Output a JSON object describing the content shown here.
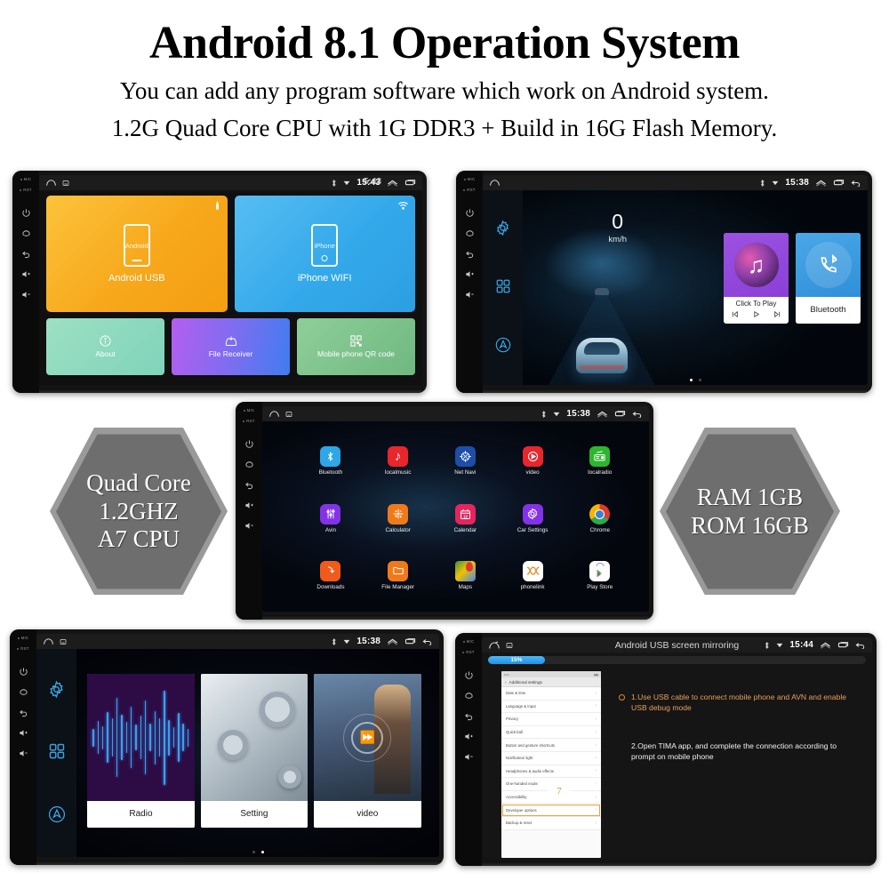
{
  "header": {
    "title": "Android 8.1 Operation System",
    "line1": "You can add any program software which work on Android system.",
    "line2": "1.2G Quad Core CPU with 1G DDR3 + Build in 16G Flash Memory."
  },
  "bezel": {
    "mic_label": "MIC",
    "rst_label": "RST",
    "buttons": [
      "power-icon",
      "home-icon",
      "back-icon",
      "volume-up-icon",
      "volume-down-icon"
    ],
    "vol_up": "+",
    "vol_down": "-"
  },
  "screen1": {
    "status": {
      "time": "15:43",
      "ghost_time": "5:43",
      "icons": [
        "home-icon",
        "screenshot-icon",
        "bluetooth-icon",
        "wifi-icon",
        "chevron-up-icon",
        "recents-icon",
        "back-icon"
      ]
    },
    "tiles": [
      {
        "label": "Android USB",
        "phone_text": "Android",
        "corner_icon": "usb-icon",
        "color": "#f7a81b"
      },
      {
        "label": "iPhone WIFI",
        "phone_text": "iPhone",
        "corner_icon": "wifi-icon",
        "color": "#34a9ea"
      }
    ],
    "mini_tiles": [
      {
        "label": "About",
        "icon": "info-icon"
      },
      {
        "label": "File Receiver",
        "icon": "inbox-download-icon"
      },
      {
        "label": "Mobile phone QR code",
        "icon": "qr-code-icon"
      }
    ]
  },
  "screen2": {
    "status": {
      "time": "15:38"
    },
    "speed": {
      "value": "0",
      "unit": "km/h"
    },
    "cards": [
      {
        "title": "Click To Play",
        "icon": "music-note-icon",
        "controls": [
          "previous-icon",
          "play-icon",
          "next-icon"
        ]
      },
      {
        "title": "Bluetooth",
        "icon": "bluetooth-phone-icon"
      }
    ],
    "rail_icons": [
      "settings-gear-icon",
      "apps-grid-icon",
      "assistant-icon"
    ],
    "page_dots": {
      "count": 2,
      "active": 0
    }
  },
  "screen3": {
    "status": {
      "time": "15:38"
    },
    "apps": [
      {
        "label": "Bluetooth",
        "icon": "bluetooth-icon",
        "color": "#2ea6e8"
      },
      {
        "label": "localmusic",
        "icon": "music-note-icon",
        "color": "#e8262b"
      },
      {
        "label": "Net Navi",
        "icon": "compass-icon",
        "color": "#1d4ea8"
      },
      {
        "label": "video",
        "icon": "play-circle-icon",
        "color": "#e8262b"
      },
      {
        "label": "localradio",
        "icon": "radio-icon",
        "color": "#2fb62f"
      },
      {
        "label": "Avin",
        "icon": "equalizer-icon",
        "color": "#8432e8"
      },
      {
        "label": "Calculator",
        "icon": "calculator-icon",
        "color": "#f07a1a"
      },
      {
        "label": "Calendar",
        "icon": "calendar-icon",
        "color": "#e8245c"
      },
      {
        "label": "Car Settings",
        "icon": "gear-icon",
        "color": "#8432e8"
      },
      {
        "label": "Chrome",
        "icon": "chrome-icon",
        "color": "#ffffff"
      },
      {
        "label": "Downloads",
        "icon": "download-icon",
        "color": "#f05a1a"
      },
      {
        "label": "File Manager",
        "icon": "folder-icon",
        "color": "#f07a1a"
      },
      {
        "label": "Maps",
        "icon": "maps-pin-icon",
        "color": "#ffffff"
      },
      {
        "label": "phonelink",
        "icon": "phonelink-icon",
        "color": "#ffffff"
      },
      {
        "label": "Play Store",
        "icon": "play-store-icon",
        "color": "#ffffff"
      }
    ]
  },
  "screen4": {
    "status": {
      "time": "15:38"
    },
    "cards": [
      {
        "label": "Radio",
        "art": "waveform-art"
      },
      {
        "label": "Setting",
        "art": "gears-art"
      },
      {
        "label": "video",
        "art": "movie-art"
      }
    ],
    "rail_icons": [
      "settings-gear-icon",
      "apps-grid-icon",
      "assistant-icon"
    ],
    "page_dots": {
      "count": 2,
      "active": 1
    }
  },
  "screen5": {
    "status": {
      "time": "15:44",
      "title": "Android USB screen mirroring"
    },
    "progress": {
      "percent_label": "15%",
      "percent": 15
    },
    "phone": {
      "header": "Additional settings",
      "rows": [
        "Date & time",
        "Language & input",
        "Privacy",
        "Quick ball",
        "Button and gesture shortcuts",
        "Notification light",
        "Headphones & audio effects",
        "One-handed mode",
        "Accessibility",
        "Developer options",
        "Backup & reset"
      ],
      "highlight_row": "Developer options",
      "badge": "7"
    },
    "steps": [
      "1.Use USB cable to connect mobile phone and AVN and enable USB debug mode",
      "2.Open TIMA app, and complete the connection according to prompt on mobile phone"
    ]
  },
  "hex_left": {
    "line1": "Quad Core",
    "line2": "1.2GHZ",
    "line3": "A7 CPU"
  },
  "hex_right": {
    "line1": "RAM 1GB",
    "line2": "ROM 16GB"
  }
}
